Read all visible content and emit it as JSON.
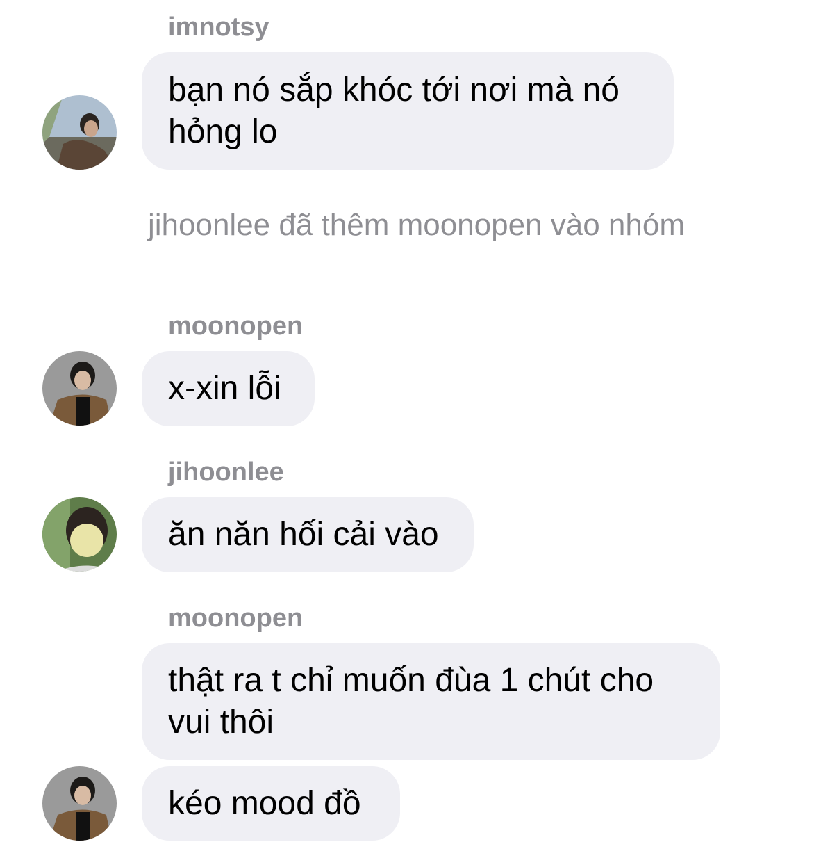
{
  "messages": [
    {
      "sender": "imnotsy",
      "lines": [
        "bạn nó sắp khóc tới nơi mà nó",
        "hỏng lo"
      ]
    },
    {
      "system": "jihoonlee đã thêm moonopen vào nhóm"
    },
    {
      "sender": "moonopen",
      "text": "x-xin lỗi"
    },
    {
      "sender": "jihoonlee",
      "text": "ăn năn hối cải vào"
    },
    {
      "sender": "moonopen",
      "lines": [
        "thật ra t chỉ muốn đùa 1 chút cho",
        "vui thôi"
      ]
    },
    {
      "text": "kéo mood đồ"
    }
  ]
}
